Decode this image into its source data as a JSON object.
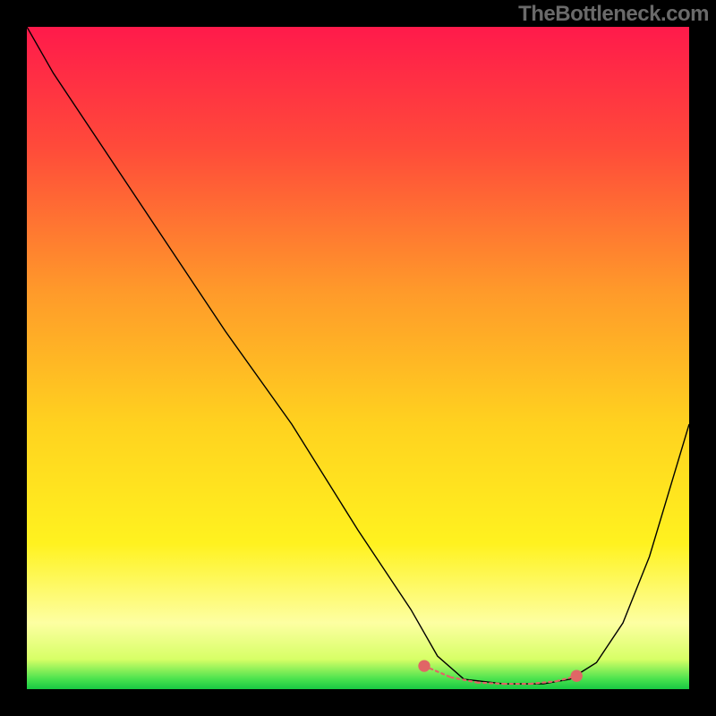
{
  "watermark": "TheBottleneck.com",
  "chart_data": {
    "type": "line",
    "title": "",
    "xlabel": "",
    "ylabel": "",
    "xlim": [
      0,
      100
    ],
    "ylim": [
      0,
      100
    ],
    "grid": false,
    "legend": false,
    "description": "Bottleneck curve drawn over a vertical red→yellow→green gradient. The black curve starts at the top-left near y≈100, drops steeply, reaches a flat minimum around x≈64–82 near y≈0, then rises toward the right edge reaching y≈40 at x=100. The flat valley segment is highlighted with a salmon-colored dotted/segmented overlay and endpoint dots.",
    "series": [
      {
        "name": "bottleneck-curve",
        "color": "#000000",
        "x": [
          0,
          4,
          10,
          20,
          30,
          40,
          50,
          58,
          62,
          66,
          72,
          78,
          82,
          86,
          90,
          94,
          100
        ],
        "y": [
          100,
          93,
          84,
          69,
          54,
          40,
          24,
          12,
          5,
          1.5,
          0.8,
          0.8,
          1.5,
          4,
          10,
          20,
          40
        ]
      }
    ],
    "highlight": {
      "name": "valley-highlight",
      "color": "#e06666",
      "x": [
        60,
        64,
        68,
        72,
        76,
        80,
        83
      ],
      "y": [
        3.5,
        1.8,
        1.0,
        0.8,
        0.8,
        1.2,
        2.0
      ]
    },
    "background_gradient_stops": [
      {
        "offset": 0.0,
        "color": "#ff1a4b"
      },
      {
        "offset": 0.18,
        "color": "#ff4a3a"
      },
      {
        "offset": 0.4,
        "color": "#ff9a2a"
      },
      {
        "offset": 0.6,
        "color": "#ffd21f"
      },
      {
        "offset": 0.78,
        "color": "#fff21f"
      },
      {
        "offset": 0.9,
        "color": "#fdffa2"
      },
      {
        "offset": 0.955,
        "color": "#d7ff66"
      },
      {
        "offset": 0.985,
        "color": "#49e24e"
      },
      {
        "offset": 1.0,
        "color": "#18c843"
      }
    ]
  }
}
